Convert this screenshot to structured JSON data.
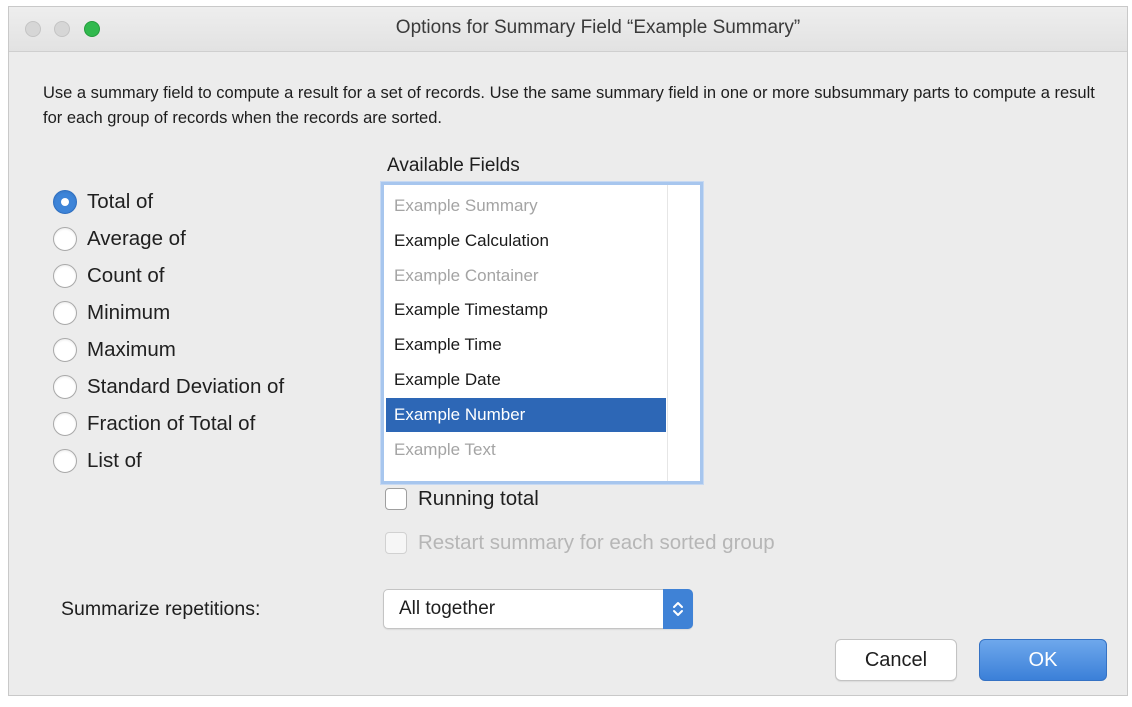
{
  "window": {
    "title": "Options for Summary Field “Example Summary”"
  },
  "description": "Use a summary field to compute a result for a set of records. Use the same summary field in one or more subsummary parts to compute a result for each group of records when the records are sorted.",
  "summary_types": [
    {
      "label": "Total of",
      "selected": true
    },
    {
      "label": "Average of",
      "selected": false
    },
    {
      "label": "Count of",
      "selected": false
    },
    {
      "label": "Minimum",
      "selected": false
    },
    {
      "label": "Maximum",
      "selected": false
    },
    {
      "label": "Standard Deviation of",
      "selected": false
    },
    {
      "label": "Fraction of Total of",
      "selected": false
    },
    {
      "label": "List of",
      "selected": false
    }
  ],
  "available_fields": {
    "heading": "Available Fields",
    "items": [
      {
        "label": "Example Summary",
        "state": "disabled"
      },
      {
        "label": "Example Calculation",
        "state": "normal"
      },
      {
        "label": "Example Container",
        "state": "disabled"
      },
      {
        "label": "Example Timestamp",
        "state": "normal"
      },
      {
        "label": "Example Time",
        "state": "normal"
      },
      {
        "label": "Example Date",
        "state": "normal"
      },
      {
        "label": "Example Number",
        "state": "selected"
      },
      {
        "label": "Example Text",
        "state": "disabled"
      }
    ]
  },
  "options": {
    "running_total": {
      "label": "Running total",
      "checked": false
    },
    "restart_summary": {
      "label": "Restart summary for each sorted group",
      "checked": false,
      "enabled": false
    }
  },
  "repetitions": {
    "label": "Summarize repetitions:",
    "value": "All together"
  },
  "buttons": {
    "cancel": "Cancel",
    "ok": "OK"
  },
  "colors": {
    "accent": "#3d84d8",
    "selection": "#2d67b6",
    "traffic_zoom": "#31b94e"
  }
}
